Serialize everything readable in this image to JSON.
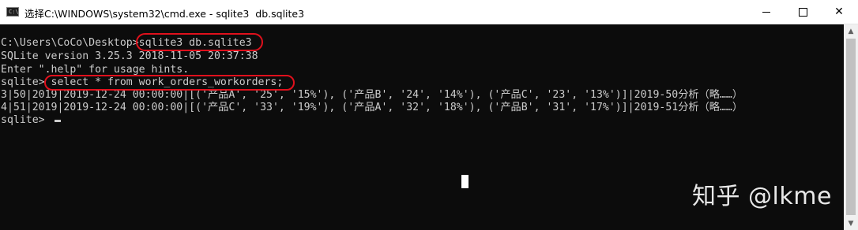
{
  "titlebar": {
    "icon": "cmd-icon",
    "icon_text": "C:\\",
    "title": "选择C:\\WINDOWS\\system32\\cmd.exe - sqlite3  db.sqlite3"
  },
  "window_buttons": {
    "minimize_icon": "minimize-icon",
    "maximize_icon": "maximize-icon",
    "close_glyph": "✕"
  },
  "terminal": {
    "lines": [
      "C:\\Users\\CoCo\\Desktop>sqlite3 db.sqlite3",
      "SQLite version 3.25.3 2018-11-05 20:37:38",
      "Enter \".help\" for usage hints.",
      "sqlite> select * from work_orders_workorders;",
      "3|50|2019|2019-12-24 00:00:00|[('产品A', '25', '15%'), ('产品B', '24', '14%'), ('产品C', '23', '13%')]|2019-50分析（略……）",
      "4|51|2019|2019-12-24 00:00:00|[('产品C', '33', '19%'), ('产品A', '32', '18%'), ('产品B', '31', '17%')]|2019-51分析（略……）",
      "sqlite> "
    ]
  },
  "watermark": "知乎 @lkme",
  "scrollbar": {
    "up_glyph": "▲",
    "down_glyph": "▼"
  },
  "colors": {
    "console_bg": "#0c0c0c",
    "console_text": "#cccccc",
    "annotation": "#e0101c",
    "titlebar_bg": "#ffffff"
  }
}
